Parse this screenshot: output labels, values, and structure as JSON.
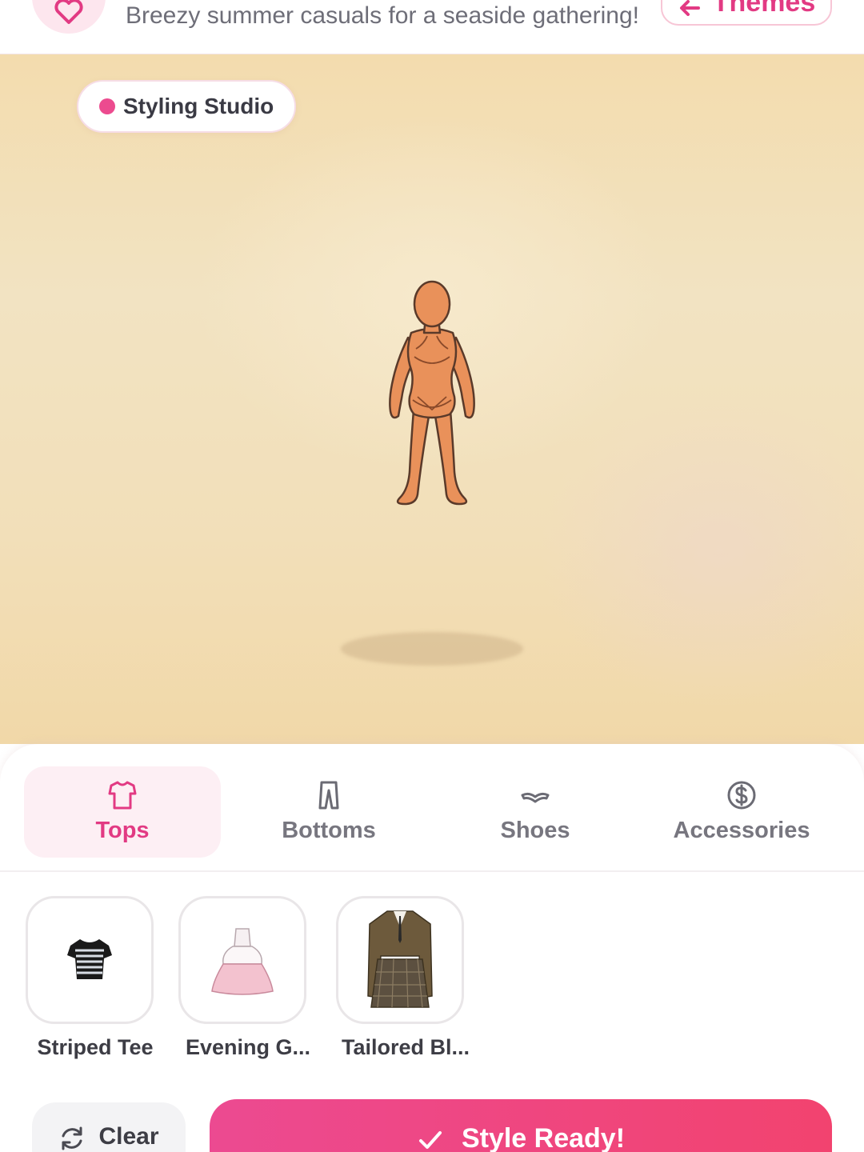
{
  "header": {
    "theme_description": "Breezy summer casuals for a seaside gathering!",
    "themes_button_label": "Themes"
  },
  "stage": {
    "badge_label": "Styling Studio"
  },
  "tabs": [
    {
      "label": "Tops",
      "icon": "shirt-icon",
      "active": true
    },
    {
      "label": "Bottoms",
      "icon": "pants-icon",
      "active": false
    },
    {
      "label": "Shoes",
      "icon": "shoe-icon",
      "active": false
    },
    {
      "label": "Accessories",
      "icon": "dollar-circle-icon",
      "active": false
    }
  ],
  "items": [
    {
      "name": "Striped Tee"
    },
    {
      "name": "Evening G..."
    },
    {
      "name": "Tailored Bl..."
    }
  ],
  "actions": {
    "clear_label": "Clear",
    "ready_label": "Style Ready!"
  },
  "colors": {
    "accent": "#e23a83",
    "stage_bg": "#f2e3c2",
    "ready_gradient_start": "#ec4a91",
    "ready_gradient_end": "#f2436f"
  }
}
